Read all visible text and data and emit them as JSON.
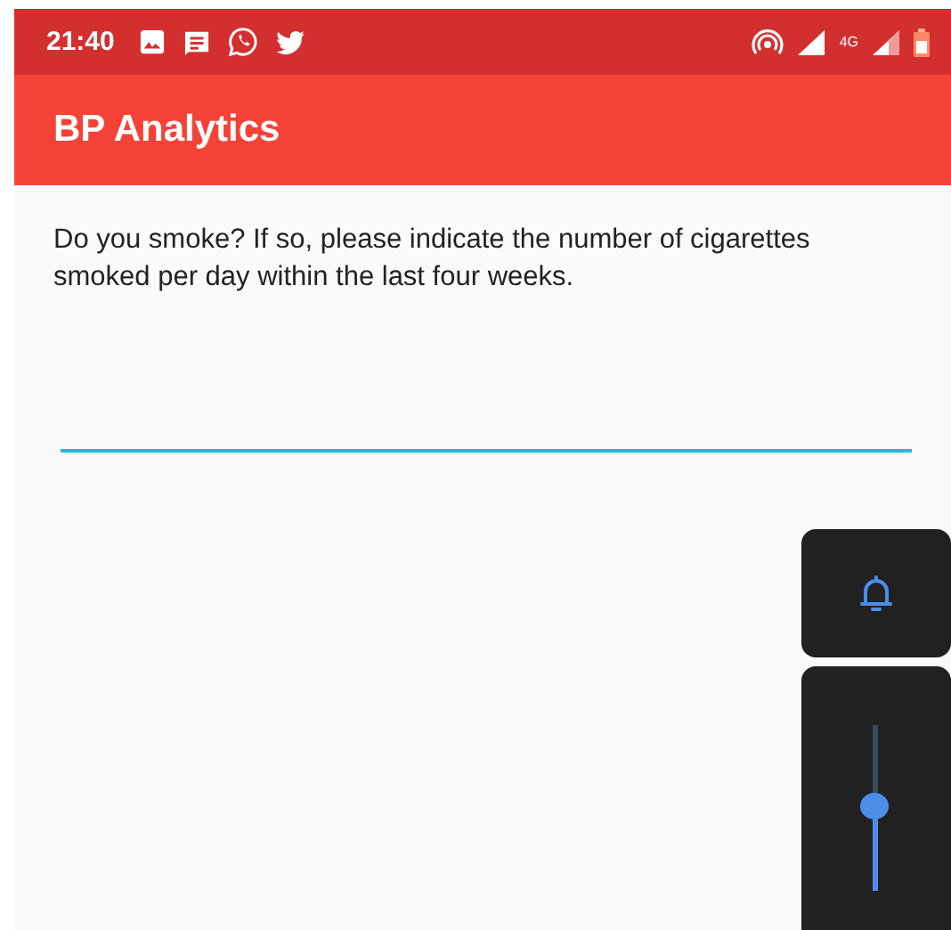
{
  "status_bar": {
    "time": "21:40",
    "network": "4G"
  },
  "app_bar": {
    "title": "BP Analytics"
  },
  "question": {
    "text": "Do you smoke? If so, please indicate the number of cigarettes smoked per day within the last four weeks."
  },
  "volume_panel": {
    "level": 0.52
  }
}
